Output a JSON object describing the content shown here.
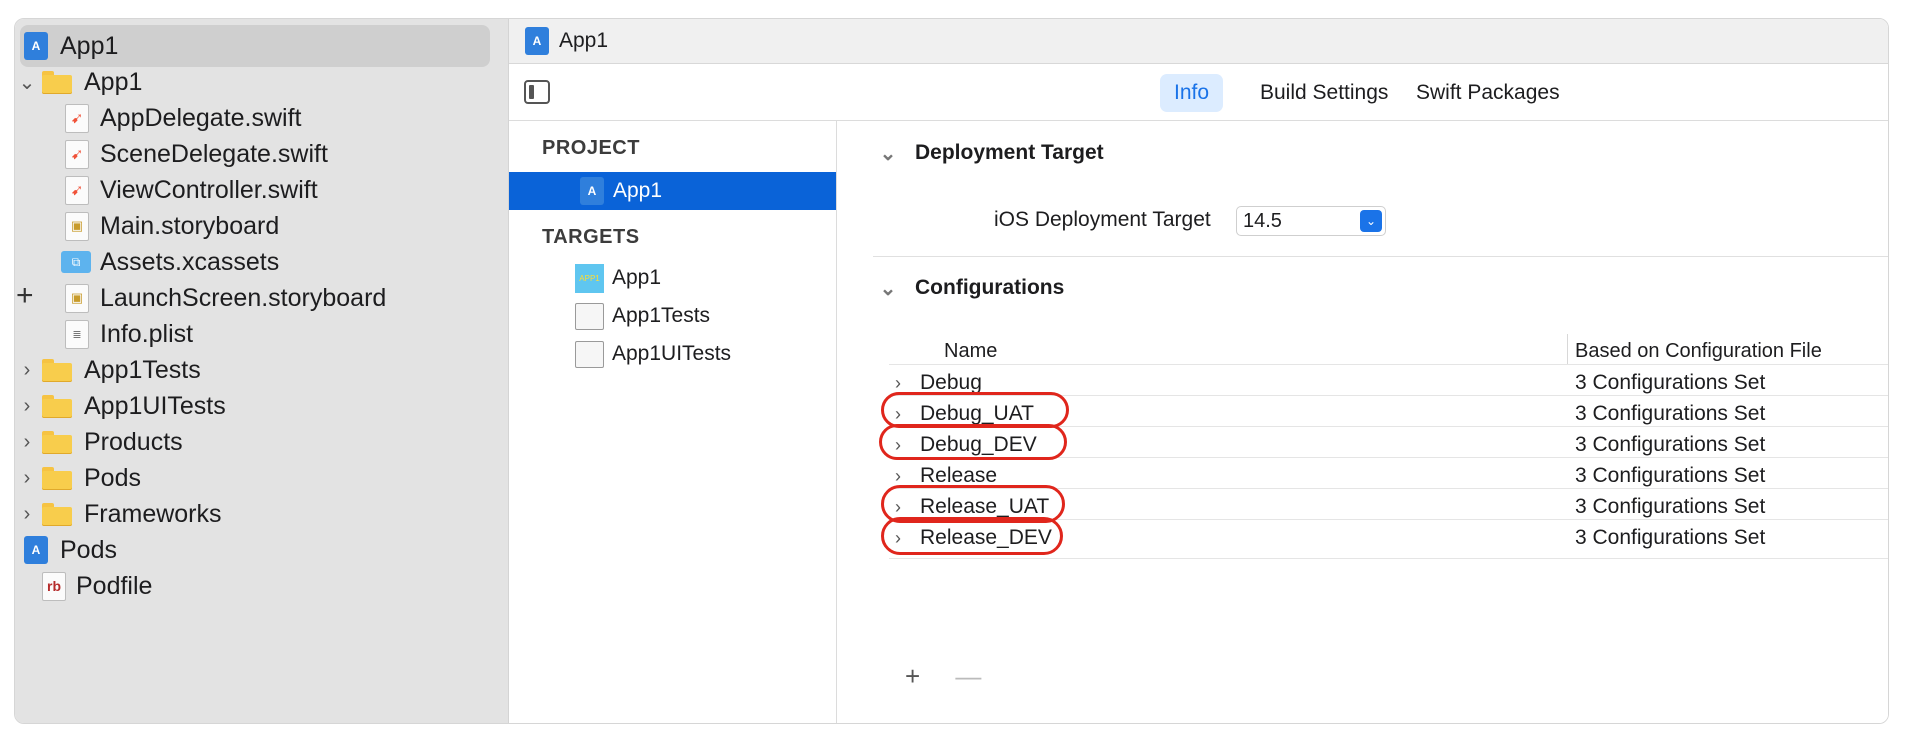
{
  "navigator": {
    "items": [
      {
        "label": "App1",
        "type": "project",
        "selected": true
      },
      {
        "label": "App1",
        "type": "folder",
        "expanded": true
      },
      {
        "label": "AppDelegate.swift",
        "type": "swift"
      },
      {
        "label": "SceneDelegate.swift",
        "type": "swift"
      },
      {
        "label": "ViewController.swift",
        "type": "swift"
      },
      {
        "label": "Main.storyboard",
        "type": "storyboard"
      },
      {
        "label": "Assets.xcassets",
        "type": "assets"
      },
      {
        "label": "LaunchScreen.storyboard",
        "type": "storyboard"
      },
      {
        "label": "Info.plist",
        "type": "plist"
      },
      {
        "label": "App1Tests",
        "type": "folder",
        "expanded": false
      },
      {
        "label": "App1UITests",
        "type": "folder",
        "expanded": false
      },
      {
        "label": "Products",
        "type": "folder",
        "expanded": false
      },
      {
        "label": "Pods",
        "type": "folder",
        "expanded": false
      },
      {
        "label": "Frameworks",
        "type": "folder",
        "expanded": false
      },
      {
        "label": "Pods",
        "type": "project"
      },
      {
        "label": "Podfile",
        "type": "ruby"
      }
    ]
  },
  "editor": {
    "tab_title": "App1",
    "tabs": [
      "Info",
      "Build Settings",
      "Swift Packages"
    ],
    "active_tab": "Info"
  },
  "project_list": {
    "project_header": "PROJECT",
    "project": "App1",
    "targets_header": "TARGETS",
    "targets": [
      "App1",
      "App1Tests",
      "App1UITests"
    ],
    "app_icon_text": "APP1"
  },
  "deployment": {
    "header": "Deployment Target",
    "label": "iOS Deployment Target",
    "value": "14.5"
  },
  "configurations": {
    "header": "Configurations",
    "col_name": "Name",
    "col_file": "Based on Configuration File",
    "rows": [
      {
        "name": "Debug",
        "file": "3 Configurations Set",
        "highlighted": false
      },
      {
        "name": "Debug_UAT",
        "file": "3 Configurations Set",
        "highlighted": true
      },
      {
        "name": "Debug_DEV",
        "file": "3 Configurations Set",
        "highlighted": true
      },
      {
        "name": "Release",
        "file": "3 Configurations Set",
        "highlighted": false
      },
      {
        "name": "Release_UAT",
        "file": "3 Configurations Set",
        "highlighted": true
      },
      {
        "name": "Release_DEV",
        "file": "3 Configurations Set",
        "highlighted": true
      }
    ],
    "add_label": "+",
    "remove_label": "—"
  },
  "colors": {
    "accent": "#1a73e8",
    "selection": "#0a63d8",
    "highlight_ring": "#e0261c",
    "folder": "#f8cd4c"
  }
}
